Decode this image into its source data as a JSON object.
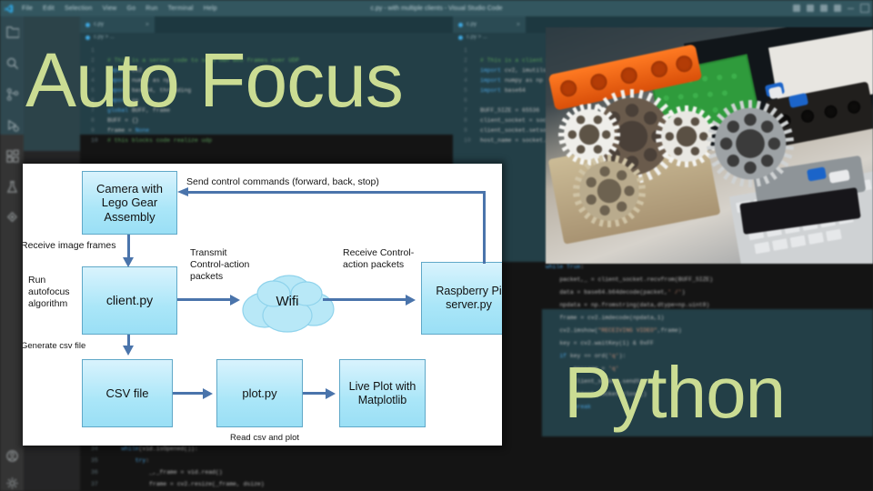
{
  "window": {
    "app_title": "c.py - with multiple clients - Visual Studio Code",
    "menu": [
      "File",
      "Edit",
      "Selection",
      "View",
      "Go",
      "Run",
      "Terminal",
      "Help"
    ],
    "logo_icon": "vscode-logo-icon",
    "controls": [
      {
        "name": "toggle-primary-sidebar-icon"
      },
      {
        "name": "toggle-panel-icon"
      },
      {
        "name": "toggle-secondary-sidebar-icon"
      },
      {
        "name": "customize-layout-icon"
      },
      {
        "name": "minimize-icon"
      },
      {
        "name": "maximize-icon"
      }
    ]
  },
  "activity_bar": {
    "items": [
      {
        "name": "explorer-icon",
        "label": "Explorer"
      },
      {
        "name": "search-icon",
        "label": "Search"
      },
      {
        "name": "source-control-icon",
        "label": "Source Control"
      },
      {
        "name": "run-and-debug-icon",
        "label": "Run and Debug"
      },
      {
        "name": "extensions-icon",
        "label": "Extensions"
      },
      {
        "name": "testing-icon",
        "label": "Testing"
      },
      {
        "name": "remote-explorer-icon",
        "label": "Remote Explorer"
      }
    ],
    "bottom_items": [
      {
        "name": "accounts-icon",
        "label": "Accounts"
      },
      {
        "name": "settings-gear-icon",
        "label": "Manage"
      }
    ]
  },
  "editors": {
    "left": {
      "tab_label": "c.py",
      "tab_close": "×",
      "breadcrumb": "c.py > ...",
      "lines": [
        {
          "n": "1",
          "text": ""
        },
        {
          "n": "2",
          "text": "# This is a server code to send own web frames over UDP"
        },
        {
          "n": "3",
          "text": "import cv2"
        },
        {
          "n": "4",
          "text": "import numpy as np"
        },
        {
          "n": "5",
          "text": "import base64, threading"
        },
        {
          "n": "6",
          "text": "import os"
        },
        {
          "n": "7",
          "text": "global BUFF, frame"
        },
        {
          "n": "8",
          "text": "BUFF = {}"
        },
        {
          "n": "9",
          "text": "frame = None"
        },
        {
          "n": "10",
          "text": "# this blocks code realize udp"
        }
      ]
    },
    "left_lower": {
      "lines": [
        {
          "n": "34",
          "text": "    while(vid.isOpened()):"
        },
        {
          "n": "35",
          "text": "        try:"
        },
        {
          "n": "36",
          "text": "            _,_frame = vid.read()"
        },
        {
          "n": "37",
          "text": "            frame = cv2.resize(_frame, dsize)"
        }
      ]
    },
    "right": {
      "tab_label": "c.py",
      "tab_close": "×",
      "breadcrumb": "c.py > ...",
      "lines": [
        {
          "n": "1",
          "text": ""
        },
        {
          "n": "2",
          "text": "# This is a client code"
        },
        {
          "n": "3",
          "text": "import cv2, imutils, socket"
        },
        {
          "n": "4",
          "text": "import numpy as np"
        },
        {
          "n": "5",
          "text": "import base64"
        },
        {
          "n": "6",
          "text": ""
        },
        {
          "n": "7",
          "text": "BUFF_SIZE = 65536"
        },
        {
          "n": "8",
          "text": "client_socket = socket.socket()"
        },
        {
          "n": "9",
          "text": "client_socket.setsockopt()"
        },
        {
          "n": "10",
          "text": "host_name = socket.gethostname()"
        }
      ]
    },
    "right_lower": {
      "lines": [
        {
          "n": "",
          "text": "while True:"
        },
        {
          "n": "",
          "text": "    packet,_ = client_socket.recvfrom(BUFF_SIZE)"
        },
        {
          "n": "",
          "text": "    data = base64.b64decode(packet,' /')"
        },
        {
          "n": "",
          "text": "    npdata = np.fromstring(data,dtype=np.uint8)"
        },
        {
          "n": "",
          "text": "    frame = cv2.imdecode(npdata,1)"
        },
        {
          "n": "",
          "text": "    cv2.imshow(\"RECEIVING VIDEO\",frame)"
        },
        {
          "n": "",
          "text": "    key = cv2.waitKey(1) & 0xFF"
        },
        {
          "n": "",
          "text": "    if key == ord('q'):"
        },
        {
          "n": "",
          "text": "        message = 'q'"
        },
        {
          "n": "",
          "text": "        client_socket.sendto(...)"
        },
        {
          "n": "",
          "text": "        client_socket.close()"
        },
        {
          "n": "",
          "text": "        break"
        }
      ]
    }
  },
  "overlay": {
    "title": "Auto Focus",
    "subtitle": "Python",
    "text_color": "#cbdc93"
  },
  "photo": {
    "name": "lego-gear-assembly-photo",
    "description": "Lego Technic gear assembly with camera on a laptop keyboard"
  },
  "diagram": {
    "box_fill": "#aae6f8",
    "box_border": "#5fa8c8",
    "arrow_color": "#4a74ab",
    "nodes": [
      {
        "id": "camera",
        "label": "Camera with Lego Gear Assembly"
      },
      {
        "id": "client",
        "label": "client.py"
      },
      {
        "id": "wifi",
        "label": "Wifi"
      },
      {
        "id": "rpi",
        "label": "Raspberry Pi server.py"
      },
      {
        "id": "csv",
        "label": "CSV file"
      },
      {
        "id": "plot",
        "label": "plot.py"
      },
      {
        "id": "liveplot",
        "label": "Live Plot with Matplotlib"
      }
    ],
    "edge_labels": [
      {
        "id": "send-control",
        "text": "Send control commands (forward, back, stop)"
      },
      {
        "id": "receive-frames",
        "text": "Receive image frames"
      },
      {
        "id": "run-autofocus",
        "text": "Run autofocus algorithm"
      },
      {
        "id": "transmit-packets",
        "text": "Transmit Control-action packets"
      },
      {
        "id": "receive-packets",
        "text": "Receive Control-action packets"
      },
      {
        "id": "generate-csv",
        "text": "Generate csv file"
      },
      {
        "id": "read-csv",
        "text": "Read csv and plot"
      }
    ]
  }
}
